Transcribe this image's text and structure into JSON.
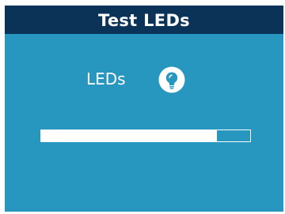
{
  "window": {
    "title": "Test LEDs"
  },
  "status": {
    "label": "LEDs",
    "icon": "lightbulb-icon"
  },
  "progress": {
    "percent": 84
  },
  "colors": {
    "background": "#2897bf",
    "title_bar": "#0b3358",
    "foreground": "#ffffff"
  }
}
